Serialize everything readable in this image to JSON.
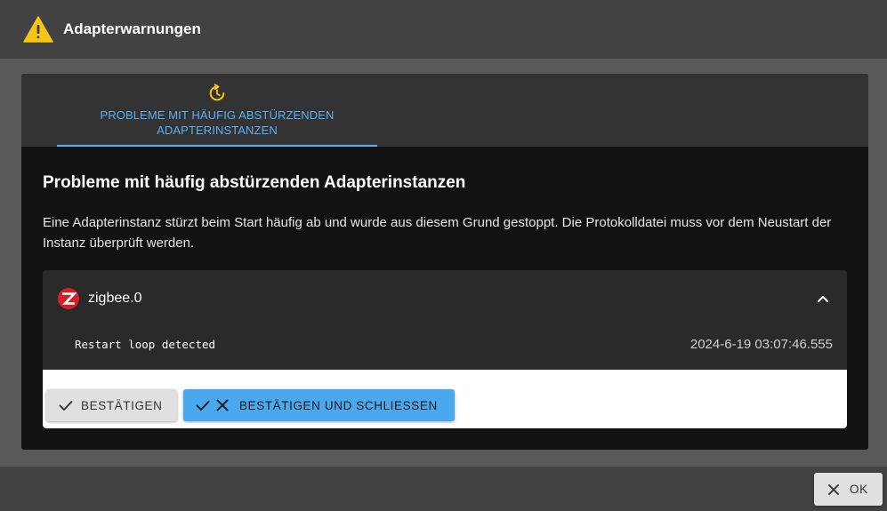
{
  "dialog": {
    "title": "Adapterwarnungen"
  },
  "tabs": [
    {
      "label": "PROBLEME MIT HÄUFIG ABSTÜRZENDEN ADAPTERINSTANZEN",
      "active": true
    }
  ],
  "panel": {
    "heading": "Probleme mit häufig abstürzenden Adapterinstanzen",
    "description": "Eine Adapterinstanz stürzt beim Start häufig ab und wurde aus diesem Grund gestoppt. Die Protokolldatei muss vor dem Neustart der Instanz überprüft werden.",
    "card": {
      "adapter_name": "zigbee.0",
      "message": "Restart loop detected",
      "timestamp": "2024-6-19 03:07:46.555",
      "confirm_label": "BESTÄTIGEN",
      "confirm_close_label": "BESTÄTIGEN UND SCHLIESSEN"
    }
  },
  "footer": {
    "ok_label": "OK"
  },
  "colors": {
    "accent": "#5ab0f0",
    "primary_button": "#4aa8ee",
    "warning": "#f5c518",
    "logo_red": "#d32027"
  },
  "icons": {
    "title": "warning-icon",
    "tab": "restart-icon",
    "adapter": "zigbee-logo",
    "collapse": "chevron-up-icon",
    "confirm": "check-icon",
    "close": "close-icon"
  }
}
